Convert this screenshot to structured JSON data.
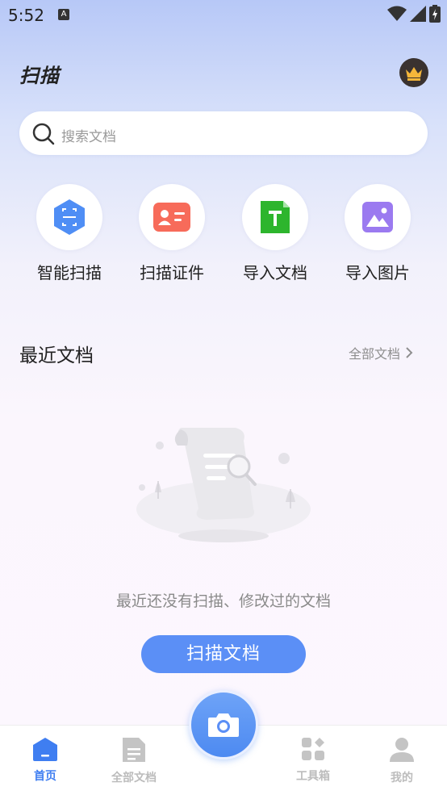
{
  "status_bar": {
    "time": "5:52",
    "notification": "A"
  },
  "header": {
    "title": "扫描"
  },
  "search": {
    "placeholder": "搜索文档"
  },
  "quick_actions": [
    {
      "label": "智能扫描",
      "icon": "smart-scan-icon",
      "color": "#4f8ef5"
    },
    {
      "label": "扫描证件",
      "icon": "id-card-icon",
      "color": "#f76b5a"
    },
    {
      "label": "导入文档",
      "icon": "import-document-icon",
      "color": "#2db52d"
    },
    {
      "label": "导入图片",
      "icon": "import-image-icon",
      "color": "#9b7af0"
    }
  ],
  "recent": {
    "title": "最近文档",
    "all_link": "全部文档",
    "empty_text": "最近还没有扫描、修改过的文档",
    "scan_button": "扫描文档"
  },
  "bottom_nav": [
    {
      "label": "首页",
      "icon": "home-icon",
      "active": true
    },
    {
      "label": "全部文档",
      "icon": "document-icon",
      "active": false
    },
    {
      "label": "工具箱",
      "icon": "toolbox-icon",
      "active": false
    },
    {
      "label": "我的",
      "icon": "profile-icon",
      "active": false
    }
  ],
  "colors": {
    "accent": "#3f7ef1",
    "button": "#5b8ff6",
    "inactive": "#bcbcbc"
  }
}
